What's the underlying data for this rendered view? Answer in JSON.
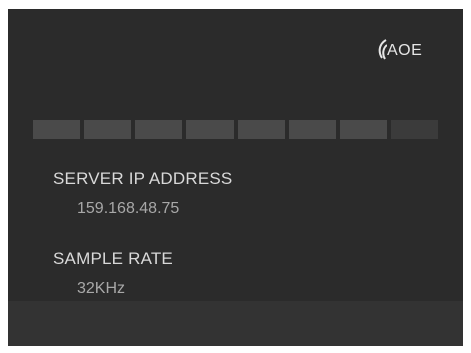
{
  "header": {
    "logo_text": "AOE",
    "logo_icon": "signal-arcs-icon"
  },
  "level_meter": {
    "segments_total": 8,
    "segments_lit": 7
  },
  "fields": {
    "server_ip": {
      "label": "SERVER IP ADDRESS",
      "value": "159.168.48.75"
    },
    "sample_rate": {
      "label": "SAMPLE RATE",
      "value": "32KHz"
    }
  },
  "colors": {
    "background": "#2b2b2b",
    "bottom_bar": "#333333",
    "segment_lit": "#4a4a4a",
    "segment_dim": "#3b3b3b",
    "label_text": "#d9d9d9",
    "value_text": "#a8a8a8"
  }
}
